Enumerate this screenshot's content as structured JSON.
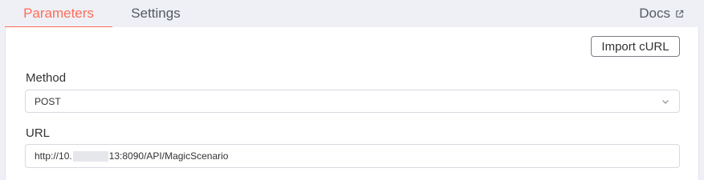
{
  "tabs": {
    "parameters": "Parameters",
    "settings": "Settings",
    "docs": "Docs"
  },
  "actions": {
    "import_curl": "Import cURL"
  },
  "fields": {
    "method": {
      "label": "Method",
      "value": "POST"
    },
    "url": {
      "label": "URL",
      "value_prefix": "http://10.",
      "value_suffix": "13:8090/API/MagicScenario"
    }
  },
  "colors": {
    "accent": "#ff6d5a",
    "background": "#eef0f5"
  },
  "icons": {
    "docs": "external-link-icon",
    "select": "chevron-down-icon"
  }
}
